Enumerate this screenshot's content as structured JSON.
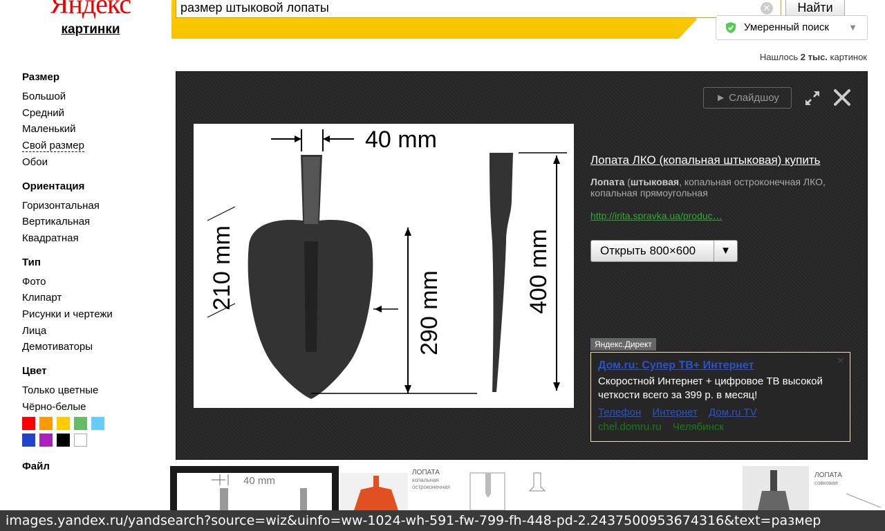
{
  "logo": {
    "brand": "Яндекс",
    "service": "картинки"
  },
  "search": {
    "query": "размер штыковой лопаты",
    "button": "Найти"
  },
  "safe_search": {
    "label": "Умеренный поиск"
  },
  "results": {
    "prefix": "Нашлось ",
    "count": "2 тыс.",
    "suffix": " картинок"
  },
  "sidebar": {
    "size": {
      "title": "Размер",
      "items": [
        "Большой",
        "Средний",
        "Маленький",
        "Свой размер",
        "Обои"
      ]
    },
    "orientation": {
      "title": "Ориентация",
      "items": [
        "Горизонтальная",
        "Вертикальная",
        "Квадратная"
      ]
    },
    "type": {
      "title": "Тип",
      "items": [
        "Фото",
        "Клипарт",
        "Рисунки и чертежи",
        "Лица",
        "Демотиваторы"
      ]
    },
    "color": {
      "title": "Цвет",
      "items": [
        "Только цветные",
        "Чёрно-белые"
      ],
      "swatches": [
        "#ff0000",
        "#ff9900",
        "#ffcc00",
        "#66bb66",
        "#66ccff",
        "#2244cc",
        "#aa22bb",
        "#000000",
        "#ffffff"
      ]
    },
    "file": {
      "title": "Файл"
    }
  },
  "viewer": {
    "slideshow": "Слайдшоу",
    "title": "Лопата ЛКО (копальная штыковая) купить",
    "desc_bold1": "Лопата",
    "desc_paren": " (",
    "desc_bold2": "штыковая",
    "desc_rest": ", копальная остроконечная ЛКО, копальная прямоугольная",
    "url": "http://irita.spravka.ua/produc…",
    "open_button": "Открыть 800×600",
    "image_labels": {
      "width": "40 mm",
      "blade": "210 mm",
      "length": "290 mm",
      "total": "400 mm"
    }
  },
  "ad": {
    "tag": "Яндекс.Директ",
    "title": "Дом.ru: Супер ТВ+ Интернет",
    "text": "Скоростной Интернет + цифровое ТВ высокой четкости всего за 399 р. в месяц!",
    "links": [
      "Телефон",
      "Интернет",
      "Дом.ru TV"
    ],
    "domain": [
      "chel.domru.ru",
      "Челябинск"
    ]
  },
  "thumbs": {
    "t1_label": "40 mm",
    "t2_title": "ЛОПАТА",
    "t2_sub1": "копальная",
    "t2_sub2": "остроконечная",
    "t3_title": "ЛОПАТА",
    "t3_sub": "совковая"
  },
  "status_url": "images.yandex.ru/yandsearch?source=wiz&uinfo=ww-1024-wh-591-fw-799-fh-448-pd-2.2437500953674316&text=размер"
}
